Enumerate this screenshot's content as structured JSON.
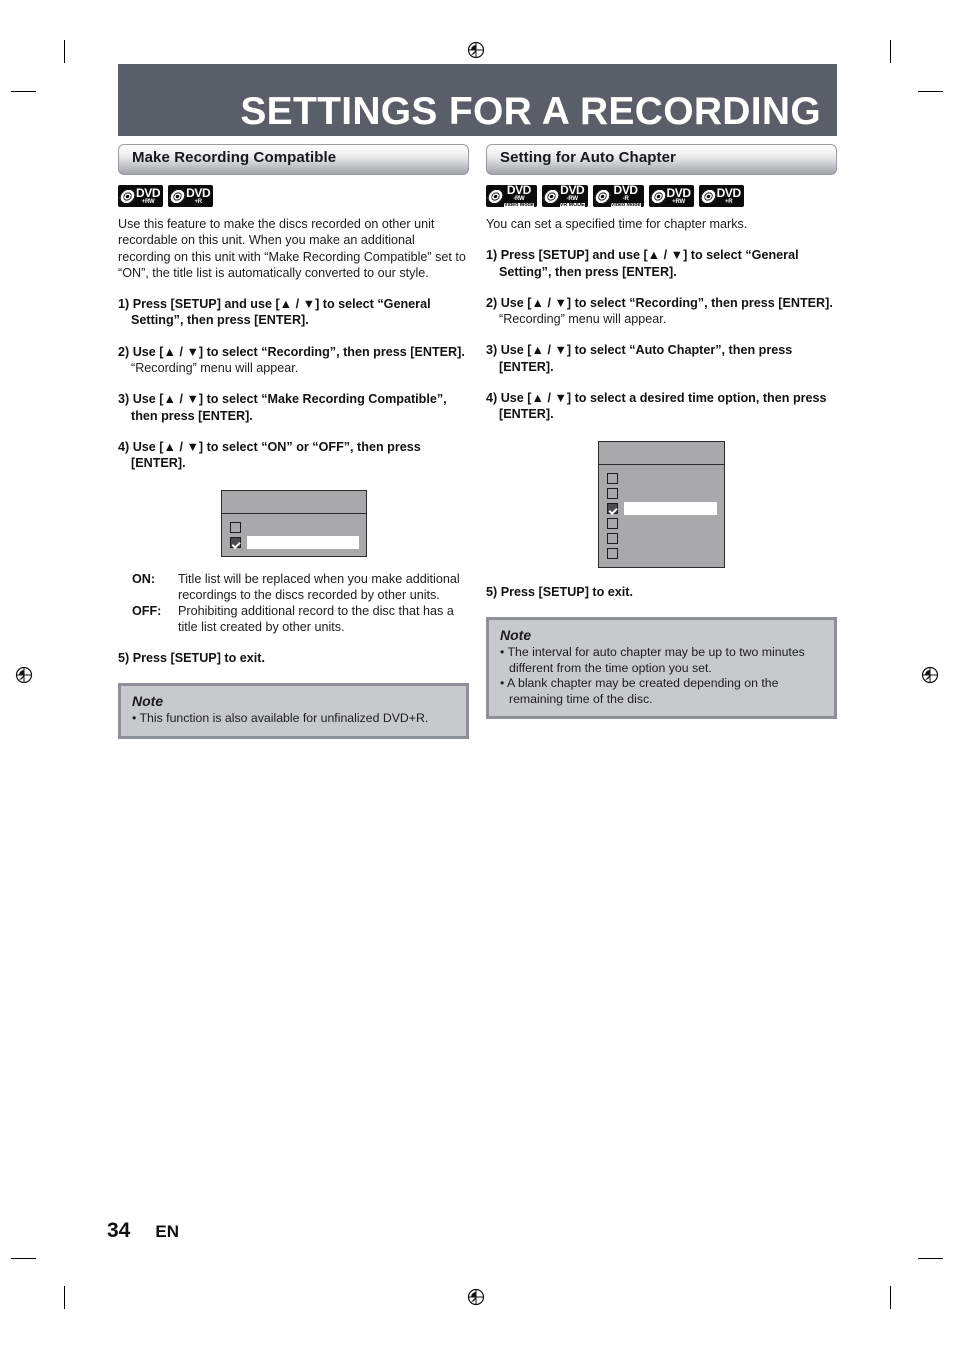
{
  "page": {
    "title": "SETTINGS FOR A RECORDING",
    "page_number": "34",
    "language_code": "EN"
  },
  "left_column": {
    "section_title": "Make Recording Compatible",
    "disc_logos": [
      {
        "main": "DVD",
        "sub": "+RW",
        "sub2": ""
      },
      {
        "main": "DVD",
        "sub": "+R",
        "sub2": ""
      }
    ],
    "intro": "Use this feature to make the discs recorded on other unit recordable on this unit. When you make an additional recording on this unit with “Make Recording Compatible” set to “ON”, the title list is automatically converted to our style.",
    "steps": [
      "1) Press [SETUP] and use [▲ / ▼] to select “General Setting”, then press [ENTER].",
      "2) Use [▲ / ▼] to select “Recording”, then press [ENTER].",
      "3) Use [▲ / ▼] to select “Make Recording Compatible”, then press [ENTER].",
      "4) Use [▲ / ▼] to select “ON” or “OFF”, then press [ENTER]."
    ],
    "step2_note": "“Recording” menu will appear.",
    "osd": {
      "rows": [
        {
          "checked": false,
          "highlighted": false
        },
        {
          "checked": true,
          "highlighted": true
        }
      ]
    },
    "definitions": [
      {
        "term": "ON:",
        "desc": "Title list will be replaced when you make additional recordings to the discs recorded by other units."
      },
      {
        "term": "OFF:",
        "desc": "Prohibiting additional record to the disc that has a title list created by other units."
      }
    ],
    "exit_step": "5) Press [SETUP] to exit.",
    "note": {
      "title": "Note",
      "items": [
        "• This function is also available for unfinalized DVD+R."
      ]
    }
  },
  "right_column": {
    "section_title": "Setting for Auto Chapter",
    "disc_logos": [
      {
        "main": "DVD",
        "sub": "-RW",
        "sub2": "Video Mode"
      },
      {
        "main": "DVD",
        "sub": "-RW",
        "sub2": "VR MODE"
      },
      {
        "main": "DVD",
        "sub": "-R",
        "sub2": "Video Mode"
      },
      {
        "main": "DVD",
        "sub": "+RW",
        "sub2": ""
      },
      {
        "main": "DVD",
        "sub": "+R",
        "sub2": ""
      }
    ],
    "intro": "You can set a specified time for chapter marks.",
    "steps": [
      "1) Press [SETUP] and use [▲ / ▼] to select “General Setting”, then press [ENTER].",
      "2) Use [▲ / ▼] to select “Recording”, then press [ENTER].",
      "3) Use [▲ / ▼] to select “Auto Chapter”, then press [ENTER].",
      "4) Use [▲ / ▼] to select a desired time option, then press [ENTER]."
    ],
    "step2_note": "“Recording” menu will appear.",
    "osd": {
      "rows": [
        {
          "checked": false,
          "highlighted": false
        },
        {
          "checked": false,
          "highlighted": false
        },
        {
          "checked": true,
          "highlighted": true
        },
        {
          "checked": false,
          "highlighted": false
        },
        {
          "checked": false,
          "highlighted": false
        },
        {
          "checked": false,
          "highlighted": false
        }
      ]
    },
    "exit_step": "5) Press [SETUP] to exit.",
    "note": {
      "title": "Note",
      "items": [
        "• The interval for auto chapter may be up to two minutes different from the time option you set.",
        "• A blank chapter may be created depending on the remaining time of the disc."
      ]
    }
  },
  "colors": {
    "title_bar": "#5a5e68",
    "osd_background": "#a9a9ab",
    "note_background": "#c8c9cd",
    "note_border": "#8d9097"
  }
}
